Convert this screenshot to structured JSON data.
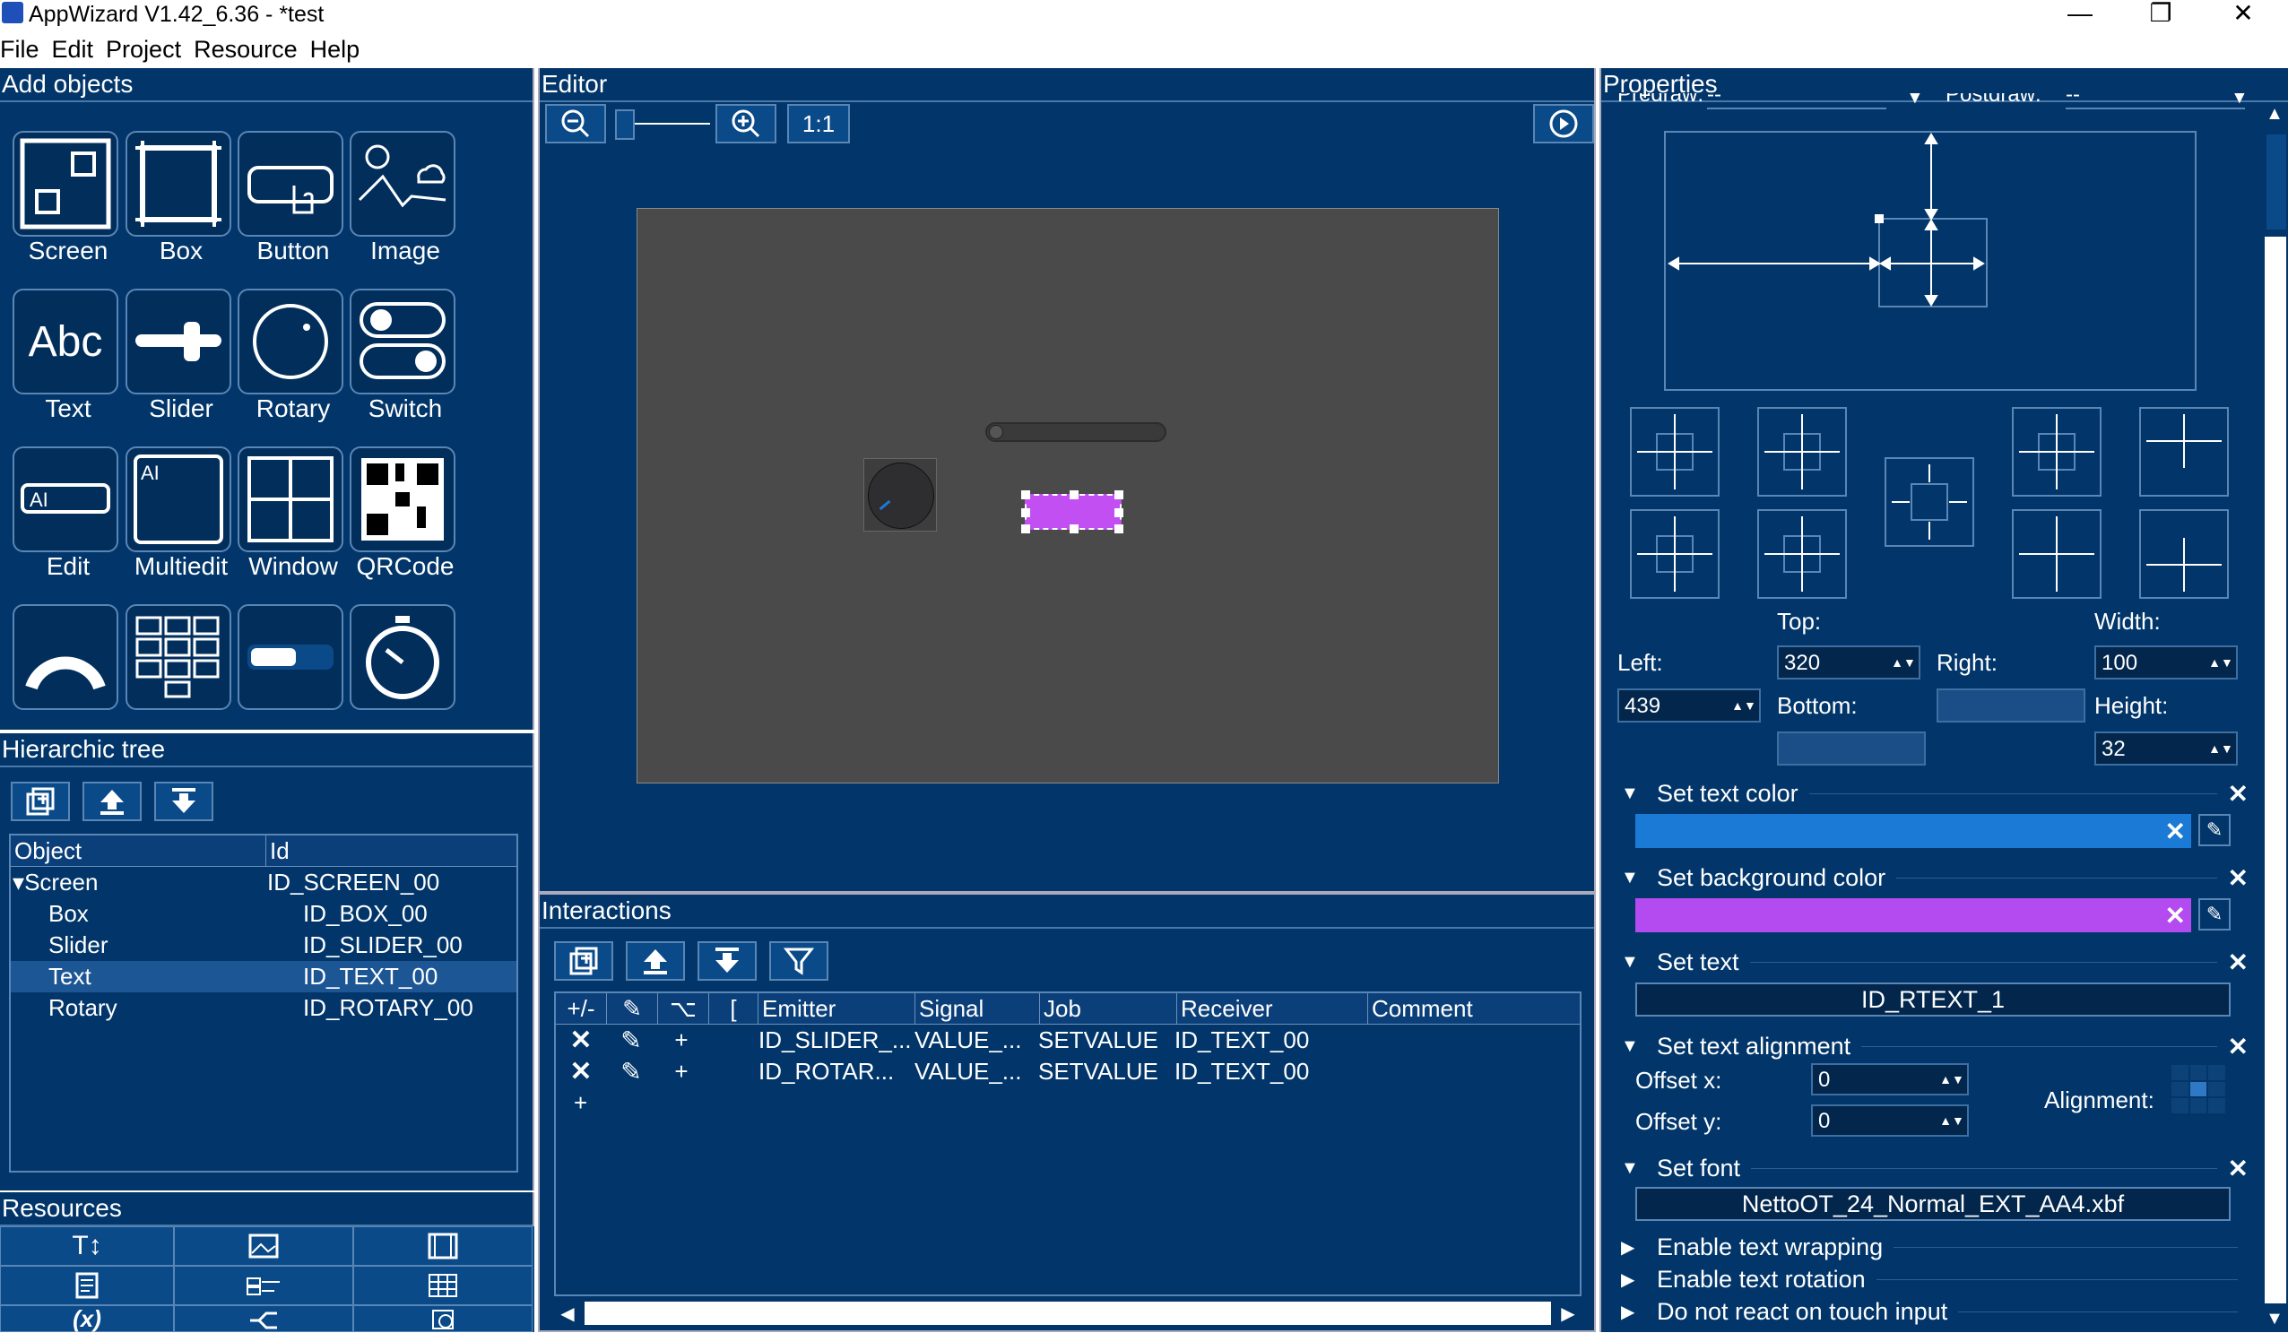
{
  "window": {
    "title": "AppWizard V1.42_6.36 - *test",
    "minimize": "—",
    "restore": "❐",
    "close": "✕"
  },
  "menu": [
    "File",
    "Edit",
    "Project",
    "Resource",
    "Help"
  ],
  "add_objects": {
    "title": "Add objects",
    "items": [
      "Screen",
      "Box",
      "Button",
      "Image",
      "Text",
      "Slider",
      "Rotary",
      "Switch",
      "Edit",
      "Multiedit",
      "Window",
      "QRCode"
    ]
  },
  "tree": {
    "title": "Hierarchic tree",
    "columns": [
      "Object",
      "Id"
    ],
    "rows": [
      {
        "object": "Screen",
        "id": "ID_SCREEN_00"
      },
      {
        "object": "Box",
        "id": "ID_BOX_00"
      },
      {
        "object": "Slider",
        "id": "ID_SLIDER_00"
      },
      {
        "object": "Text",
        "id": "ID_TEXT_00"
      },
      {
        "object": "Rotary",
        "id": "ID_ROTARY_00"
      }
    ]
  },
  "resources": {
    "title": "Resources"
  },
  "editor": {
    "title": "Editor",
    "zoom_reset": "1:1"
  },
  "interactions": {
    "title": "Interactions",
    "columns": [
      "+/-",
      "",
      "⌥",
      "[",
      "Emitter",
      "Signal",
      "Job",
      "Receiver",
      "Comment"
    ],
    "rows": [
      {
        "plus": "+",
        "emitter": "ID_SLIDER_...",
        "signal": "VALUE_...",
        "job": "SETVALUE",
        "receiver": "ID_TEXT_00"
      },
      {
        "plus": "+",
        "emitter": "ID_ROTAR...",
        "signal": "VALUE_...",
        "job": "SETVALUE",
        "receiver": "ID_TEXT_00"
      }
    ],
    "add": "+"
  },
  "properties": {
    "title": "Properties",
    "predraw_label": "Predraw:",
    "predraw_value": "--",
    "postdraw_label": "Postdraw:",
    "postdraw_value": "--",
    "top_label": "Top:",
    "top_value": "320",
    "width_label": "Width:",
    "width_value": "100",
    "left_label": "Left:",
    "left_value": "439",
    "right_label": "Right:",
    "right_value": "",
    "bottom_label": "Bottom:",
    "bottom_value": "",
    "height_label": "Height:",
    "height_value": "32",
    "set_text_color": "Set text color",
    "text_color": "#1a7ad6",
    "set_bg_color": "Set background color",
    "bg_color": "#b44bf0",
    "set_text": "Set text",
    "text_value": "ID_RTEXT_1",
    "set_text_alignment": "Set text alignment",
    "offset_x_label": "Offset x:",
    "offset_x": "0",
    "offset_y_label": "Offset y:",
    "offset_y": "0",
    "alignment_label": "Alignment:",
    "set_font": "Set font",
    "font_value": "NettoOT_24_Normal_EXT_AA4.xbf",
    "enable_wrap": "Enable text wrapping",
    "enable_rotation": "Enable text rotation",
    "no_touch": "Do not react on touch input"
  }
}
